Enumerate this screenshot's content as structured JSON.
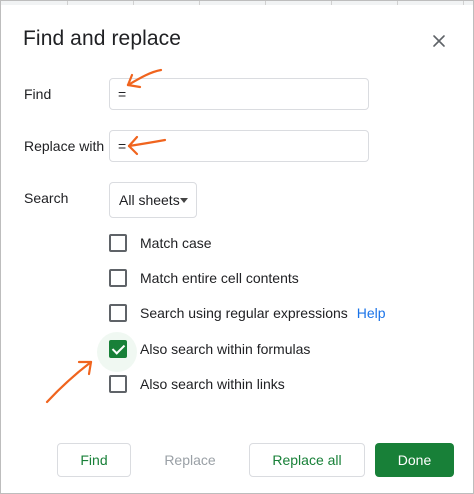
{
  "dialog": {
    "title": "Find and replace"
  },
  "find": {
    "label": "Find",
    "value": "="
  },
  "replace": {
    "label": "Replace with",
    "value": "="
  },
  "search": {
    "label": "Search",
    "selected": "All sheets"
  },
  "options": [
    {
      "label": "Match case",
      "checked": false
    },
    {
      "label": "Match entire cell contents",
      "checked": false
    },
    {
      "label": "Search using regular expressions",
      "checked": false
    },
    {
      "label": "Also search within formulas",
      "checked": true
    },
    {
      "label": "Also search within links",
      "checked": false
    }
  ],
  "help": {
    "label": "Help"
  },
  "buttons": {
    "find": "Find",
    "replace": "Replace",
    "replace_all": "Replace all",
    "done": "Done"
  },
  "colors": {
    "accent": "#188038",
    "link": "#1a73e8",
    "annotation": "#f0641e"
  },
  "icons": {
    "close": "close-icon",
    "dropdown": "caret-down-icon"
  }
}
